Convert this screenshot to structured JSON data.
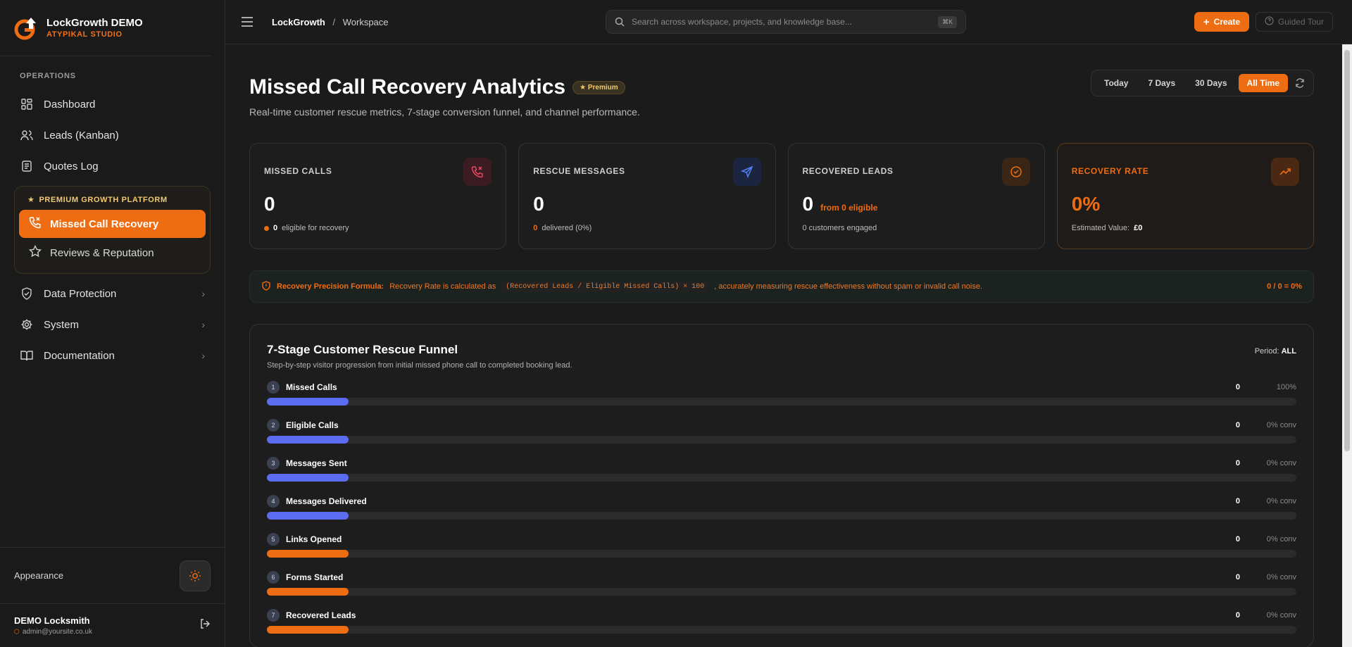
{
  "brand": {
    "name": "LockGrowth DEMO",
    "studio": "ATYPIKAL STUDIO"
  },
  "sidebar": {
    "section": "OPERATIONS",
    "items": [
      {
        "label": "Dashboard"
      },
      {
        "label": "Leads (Kanban)"
      },
      {
        "label": "Quotes Log"
      }
    ],
    "premium_title": "PREMIUM GROWTH PLATFORM",
    "premium_items": [
      {
        "label": "Missed Call Recovery"
      },
      {
        "label": "Reviews & Reputation"
      }
    ],
    "more_items": [
      {
        "label": "Data Protection"
      },
      {
        "label": "System"
      },
      {
        "label": "Documentation"
      }
    ],
    "appearance_label": "Appearance",
    "user": {
      "name": "DEMO Locksmith",
      "email": "admin@yoursite.co.uk"
    }
  },
  "topbar": {
    "breadcrumb_root": "LockGrowth",
    "breadcrumb_sep": "/",
    "breadcrumb_current": "Workspace",
    "search_placeholder": "Search across workspace, projects, and knowledge base...",
    "search_kbd": "⌘K",
    "create_label": "Create",
    "tour_label": "Guided Tour"
  },
  "page": {
    "title": "Missed Call Recovery Analytics",
    "badge": "★ Premium",
    "subtitle": "Real-time customer rescue metrics, 7-stage conversion funnel, and channel performance.",
    "periods": [
      "Today",
      "7 Days",
      "30 Days",
      "All Time"
    ],
    "active_period": "All Time"
  },
  "cards": [
    {
      "label": "MISSED CALLS",
      "value": "0",
      "sub_num": "0",
      "sub_text": "eligible for recovery"
    },
    {
      "label": "RESCUE MESSAGES",
      "value": "0",
      "sub_num": "0",
      "sub_text": "delivered (0%)"
    },
    {
      "label": "RECOVERED LEADS",
      "value": "0",
      "from": "from 0 eligible",
      "sub_text": "0 customers engaged"
    },
    {
      "label": "RECOVERY RATE",
      "value": "0%",
      "sub_text": "Estimated Value:",
      "sub_value": "£0"
    }
  ],
  "formula": {
    "label": "Recovery Precision Formula:",
    "text1": "Recovery Rate is calculated as",
    "code": "(Recovered Leads / Eligible Missed Calls) × 100",
    "text2": ", accurately measuring rescue effectiveness without spam or invalid call noise.",
    "result": "0 / 0 = 0%"
  },
  "funnel": {
    "title": "7-Stage Customer Rescue Funnel",
    "subtitle": "Step-by-step visitor progression from initial missed phone call to completed booking lead.",
    "period_label": "Period:",
    "period_value": "ALL",
    "stages": [
      {
        "n": "1",
        "name": "Missed Calls",
        "count": "0",
        "conv": "100%",
        "color": "#5b6cf0"
      },
      {
        "n": "2",
        "name": "Eligible Calls",
        "count": "0",
        "conv": "0% conv",
        "color": "#5b6cf0"
      },
      {
        "n": "3",
        "name": "Messages Sent",
        "count": "0",
        "conv": "0% conv",
        "color": "#5b6cf0"
      },
      {
        "n": "4",
        "name": "Messages Delivered",
        "count": "0",
        "conv": "0% conv",
        "color": "#5b6cf0"
      },
      {
        "n": "5",
        "name": "Links Opened",
        "count": "0",
        "conv": "0% conv",
        "color": "#ee6d12"
      },
      {
        "n": "6",
        "name": "Forms Started",
        "count": "0",
        "conv": "0% conv",
        "color": "#ee6d12"
      },
      {
        "n": "7",
        "name": "Recovered Leads",
        "count": "0",
        "conv": "0% conv",
        "color": "#ee6d12"
      }
    ]
  },
  "colors": {
    "accent": "#ee6d12",
    "premium": "#f3c871",
    "funnel_blue": "#5b6cf0"
  }
}
